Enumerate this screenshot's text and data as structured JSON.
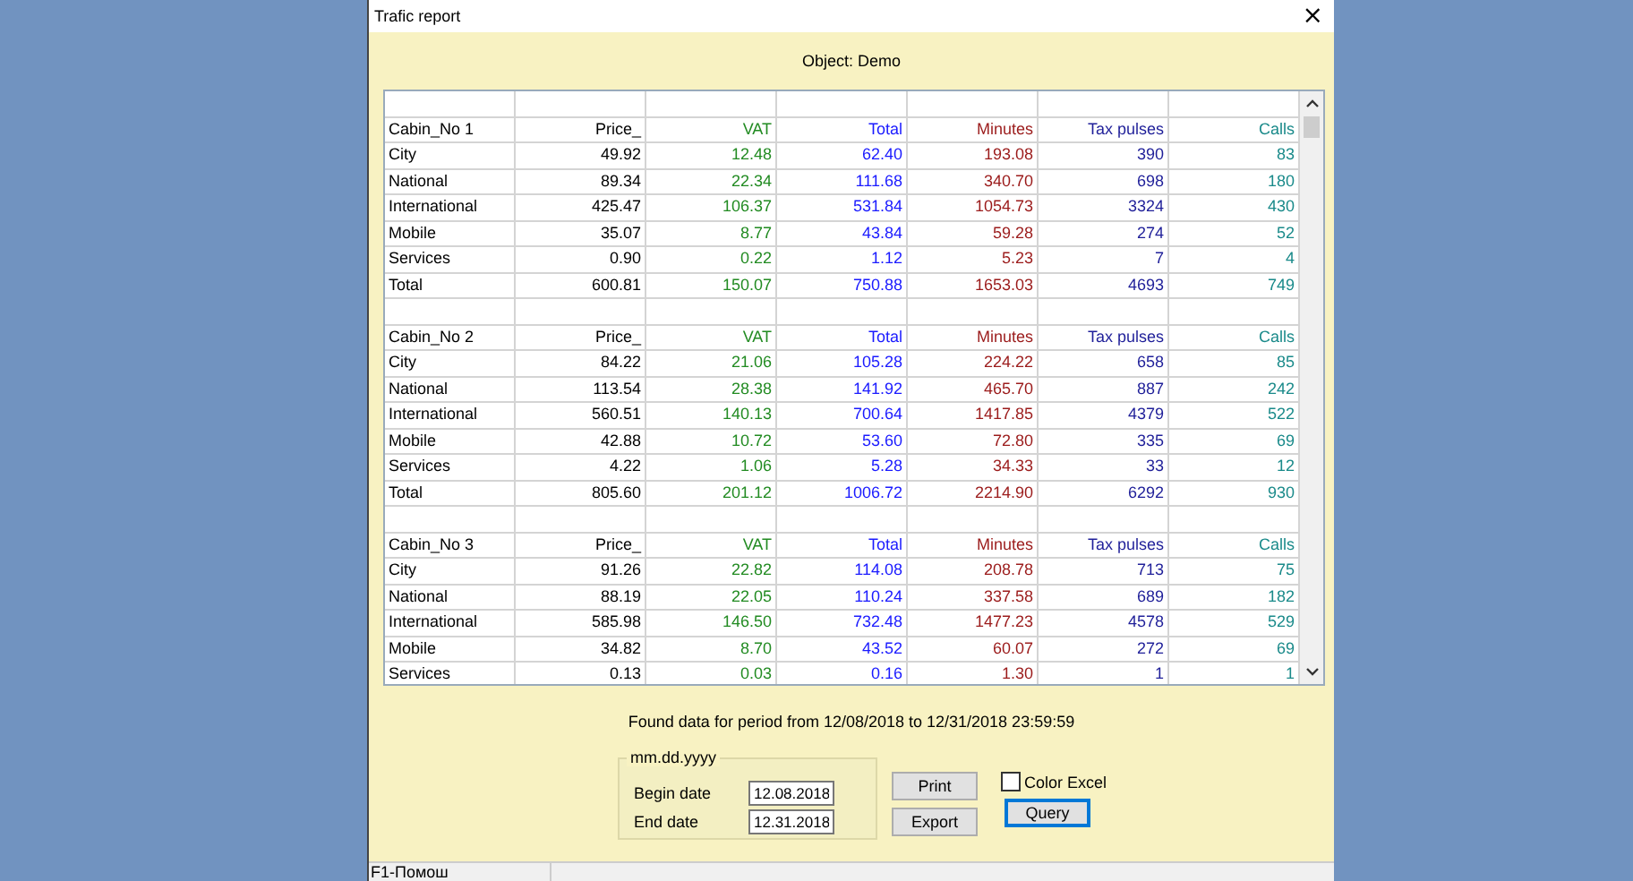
{
  "window": {
    "title": "Trafic report",
    "close": "×"
  },
  "object_label": "Object:  Demo",
  "table": {
    "columns": [
      {
        "color": "#000000"
      },
      {
        "color": "#000000"
      },
      {
        "color": "#228b22"
      },
      {
        "color": "#1a1aff"
      },
      {
        "color": "#9b1b1b"
      },
      {
        "color": "#1f1f99"
      },
      {
        "color": "#1a8a8a"
      }
    ],
    "groups": [
      {
        "header": [
          "Cabin_No  1",
          "Price_",
          "VAT",
          "Total",
          "Minutes",
          "Tax pulses",
          "Calls"
        ],
        "rows": [
          [
            "City",
            "49.92",
            "12.48",
            "62.40",
            "193.08",
            "390",
            "83"
          ],
          [
            "National",
            "89.34",
            "22.34",
            "111.68",
            "340.70",
            "698",
            "180"
          ],
          [
            "International",
            "425.47",
            "106.37",
            "531.84",
            "1054.73",
            "3324",
            "430"
          ],
          [
            "Mobile",
            "35.07",
            "8.77",
            "43.84",
            "59.28",
            "274",
            "52"
          ],
          [
            "Services",
            "0.90",
            "0.22",
            "1.12",
            "5.23",
            "7",
            "4"
          ],
          [
            "Total",
            "600.81",
            "150.07",
            "750.88",
            "1653.03",
            "4693",
            "749"
          ]
        ]
      },
      {
        "header": [
          "Cabin_No  2",
          "Price_",
          "VAT",
          "Total",
          "Minutes",
          "Tax pulses",
          "Calls"
        ],
        "rows": [
          [
            "City",
            "84.22",
            "21.06",
            "105.28",
            "224.22",
            "658",
            "85"
          ],
          [
            "National",
            "113.54",
            "28.38",
            "141.92",
            "465.70",
            "887",
            "242"
          ],
          [
            "International",
            "560.51",
            "140.13",
            "700.64",
            "1417.85",
            "4379",
            "522"
          ],
          [
            "Mobile",
            "42.88",
            "10.72",
            "53.60",
            "72.80",
            "335",
            "69"
          ],
          [
            "Services",
            "4.22",
            "1.06",
            "5.28",
            "34.33",
            "33",
            "12"
          ],
          [
            "Total",
            "805.60",
            "201.12",
            "1006.72",
            "2214.90",
            "6292",
            "930"
          ]
        ]
      },
      {
        "header": [
          "Cabin_No  3",
          "Price_",
          "VAT",
          "Total",
          "Minutes",
          "Tax pulses",
          "Calls"
        ],
        "rows": [
          [
            "City",
            "91.26",
            "22.82",
            "114.08",
            "208.78",
            "713",
            "75"
          ],
          [
            "National",
            "88.19",
            "22.05",
            "110.24",
            "337.58",
            "689",
            "182"
          ],
          [
            "International",
            "585.98",
            "146.50",
            "732.48",
            "1477.23",
            "4578",
            "529"
          ],
          [
            "Mobile",
            "34.82",
            "8.70",
            "43.52",
            "60.07",
            "272",
            "69"
          ],
          [
            "Services",
            "0.13",
            "0.03",
            "0.16",
            "1.30",
            "1",
            "1"
          ]
        ]
      }
    ]
  },
  "found_text": "Found data for period from 12/08/2018  to 12/31/2018 23:59:59",
  "date_group": {
    "legend": "mm.dd.yyyy",
    "begin_label": "Begin date",
    "begin_value": "12.08.2018",
    "end_label": "End date",
    "end_value": "12.31.2018"
  },
  "buttons": {
    "print": "Print",
    "export": "Export",
    "query": "Query"
  },
  "color_excel": {
    "label": "Color Excel",
    "checked": false
  },
  "status_bar": "F1-Помош"
}
